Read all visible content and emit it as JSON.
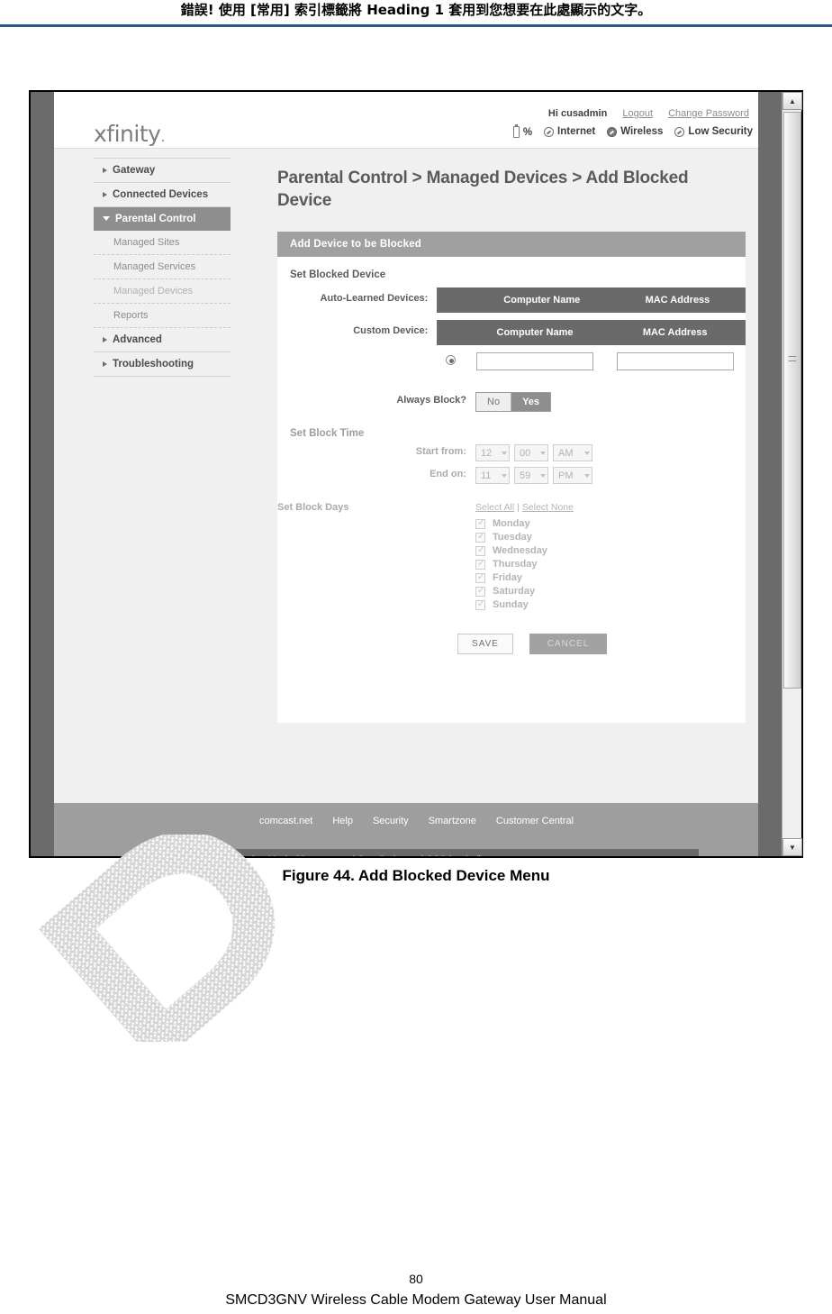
{
  "document": {
    "header_note": "錯誤! 使用 [常用] 索引標籤將 Heading 1 套用到您想要在此處顯示的文字。",
    "figure_caption": "Figure 44. Add Blocked Device Menu",
    "page_number": "80",
    "manual_title": "SMCD3GNV Wireless Cable Modem Gateway User Manual"
  },
  "topbar": {
    "logo": "xfinity",
    "greeting": "Hi cusadmin",
    "logout": "Logout",
    "change_password": "Change Password",
    "battery_label": "%",
    "status": [
      {
        "label": "Internet",
        "icon": "globe-icon"
      },
      {
        "label": "Wireless",
        "icon": "wireless-icon"
      },
      {
        "label": "Low Security",
        "icon": "security-icon"
      }
    ]
  },
  "sidebar": {
    "items": [
      {
        "label": "Gateway",
        "type": "top",
        "state": "collapsed"
      },
      {
        "label": "Connected Devices",
        "type": "top",
        "state": "collapsed"
      },
      {
        "label": "Parental Control",
        "type": "top",
        "state": "expanded-active"
      },
      {
        "label": "Managed Sites",
        "type": "sub",
        "state": "normal"
      },
      {
        "label": "Managed Services",
        "type": "sub",
        "state": "normal"
      },
      {
        "label": "Managed Devices",
        "type": "sub",
        "state": "dim"
      },
      {
        "label": "Reports",
        "type": "sub",
        "state": "normal"
      },
      {
        "label": "Advanced",
        "type": "top",
        "state": "collapsed"
      },
      {
        "label": "Troubleshooting",
        "type": "top",
        "state": "collapsed"
      }
    ]
  },
  "main": {
    "page_title": "Parental Control > Managed Devices > Add Blocked Device",
    "panel_title": "Add Device to be Blocked",
    "set_blocked_device_label": "Set Blocked Device",
    "auto_learned_label": "Auto-Learned Devices:",
    "custom_device_label": "Custom Device:",
    "table_headers": {
      "computer_name": "Computer Name",
      "mac_address": "MAC Address"
    },
    "custom_row": {
      "computer_name_value": "",
      "computer_name_placeholder": "",
      "mac_address_value": "",
      "mac_address_placeholder": ""
    },
    "always_block": {
      "label": "Always Block?",
      "options": [
        "No",
        "Yes"
      ],
      "selected": "Yes"
    },
    "set_block_time": {
      "label": "Set Block Time",
      "start_label": "Start from:",
      "start_hour": "12",
      "start_minute": "00",
      "start_meridiem": "AM",
      "end_label": "End on:",
      "end_hour": "11",
      "end_minute": "59",
      "end_meridiem": "PM",
      "disabled": true
    },
    "set_block_days": {
      "label": "Set Block Days",
      "select_all": "Select All",
      "separator": "|",
      "select_none": "Select None",
      "days": [
        "Monday",
        "Tuesday",
        "Wednesday",
        "Thursday",
        "Friday",
        "Saturday",
        "Sunday"
      ],
      "all_checked": true,
      "disabled": true
    },
    "buttons": {
      "save": "SAVE",
      "cancel": "CANCEL"
    }
  },
  "footer": {
    "links": [
      "comcast.net",
      "Help",
      "Security",
      "Smartzone",
      "Customer Central"
    ],
    "production_mode": "Production Mode (Compressed JavaScript and CSS loaded)"
  },
  "colors": {
    "accent_rule": "#2e5984",
    "nav_active": "#8e8e8e",
    "table_header": "#6a6a6a",
    "panel_header": "#a0a0a0",
    "footer": "#9e9e9e"
  }
}
